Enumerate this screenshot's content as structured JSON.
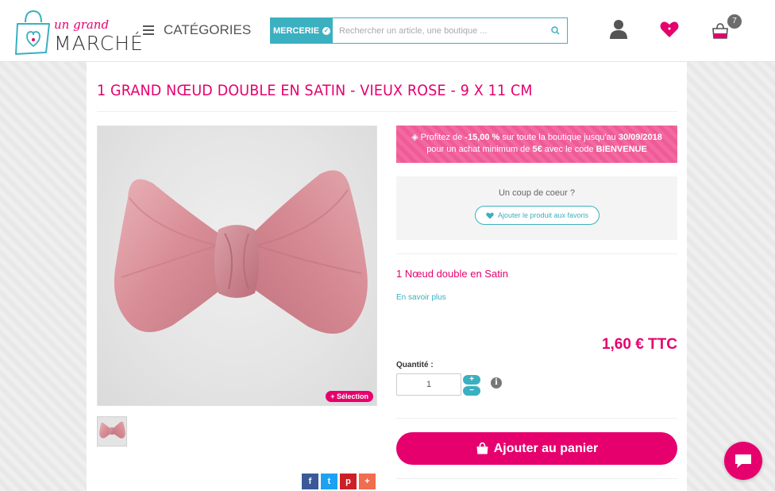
{
  "brand": {
    "logo_line1": "un grand",
    "logo_line2": "MARCHÉ",
    "accent_color": "#e6006e",
    "teal_color": "#3bb0c0"
  },
  "header": {
    "categories_label": "CATÉGORIES",
    "search_category": "MERCERIE",
    "search_placeholder": "Rechercher un article, une boutique ...",
    "icons": [
      "menu-icon",
      "check-icon",
      "search-icon",
      "user-icon",
      "heart-icon",
      "cart-icon"
    ],
    "cart_count": "7"
  },
  "product": {
    "title": "1 GRAND NŒUD DOUBLE EN SATIN - VIEUX ROSE - 9 X 11 CM",
    "selection_badge": "+ Sélection",
    "promo": {
      "pre": "Profitez de",
      "discount": "-15,00 %",
      "mid": "sur toute la boutique jusqu'au",
      "date": "30/09/2018",
      "line2_pre": "pour un achat minimum de",
      "minimum": "5€",
      "line2_mid": "avec le code",
      "code": "BIENVENUE"
    },
    "favorite_question": "Un coup de coeur ?",
    "favorite_button": "Ajouter le produit aux favoris",
    "short_description": "1 Nœud double en Satin",
    "more_link": "En savoir plus",
    "price": "1,60 € TTC",
    "quantity_label": "Quantité :",
    "quantity_value": "1",
    "stepper_plus": "+",
    "stepper_minus": "−",
    "info_symbol": "i",
    "add_to_cart": "Ajouter au panier",
    "share_labels": [
      "f",
      "t",
      "p",
      "+"
    ],
    "share_colors": [
      "#3b5998",
      "#1da1f2",
      "#cb2027",
      "#f06d50"
    ]
  }
}
